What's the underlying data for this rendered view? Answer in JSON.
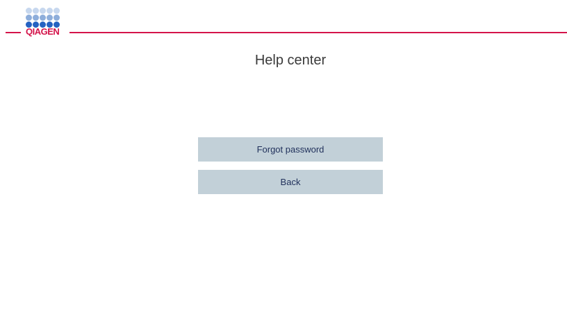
{
  "header": {
    "logo_text": "QIAGEN",
    "colors": {
      "brand_red": "#d4134a",
      "dot_light": "#b9cde9",
      "dot_mid": "#6e97d1",
      "dot_dark": "#1e5fbf"
    }
  },
  "page": {
    "title": "Help center"
  },
  "buttons": {
    "forgot_password": "Forgot password",
    "back": "Back"
  }
}
